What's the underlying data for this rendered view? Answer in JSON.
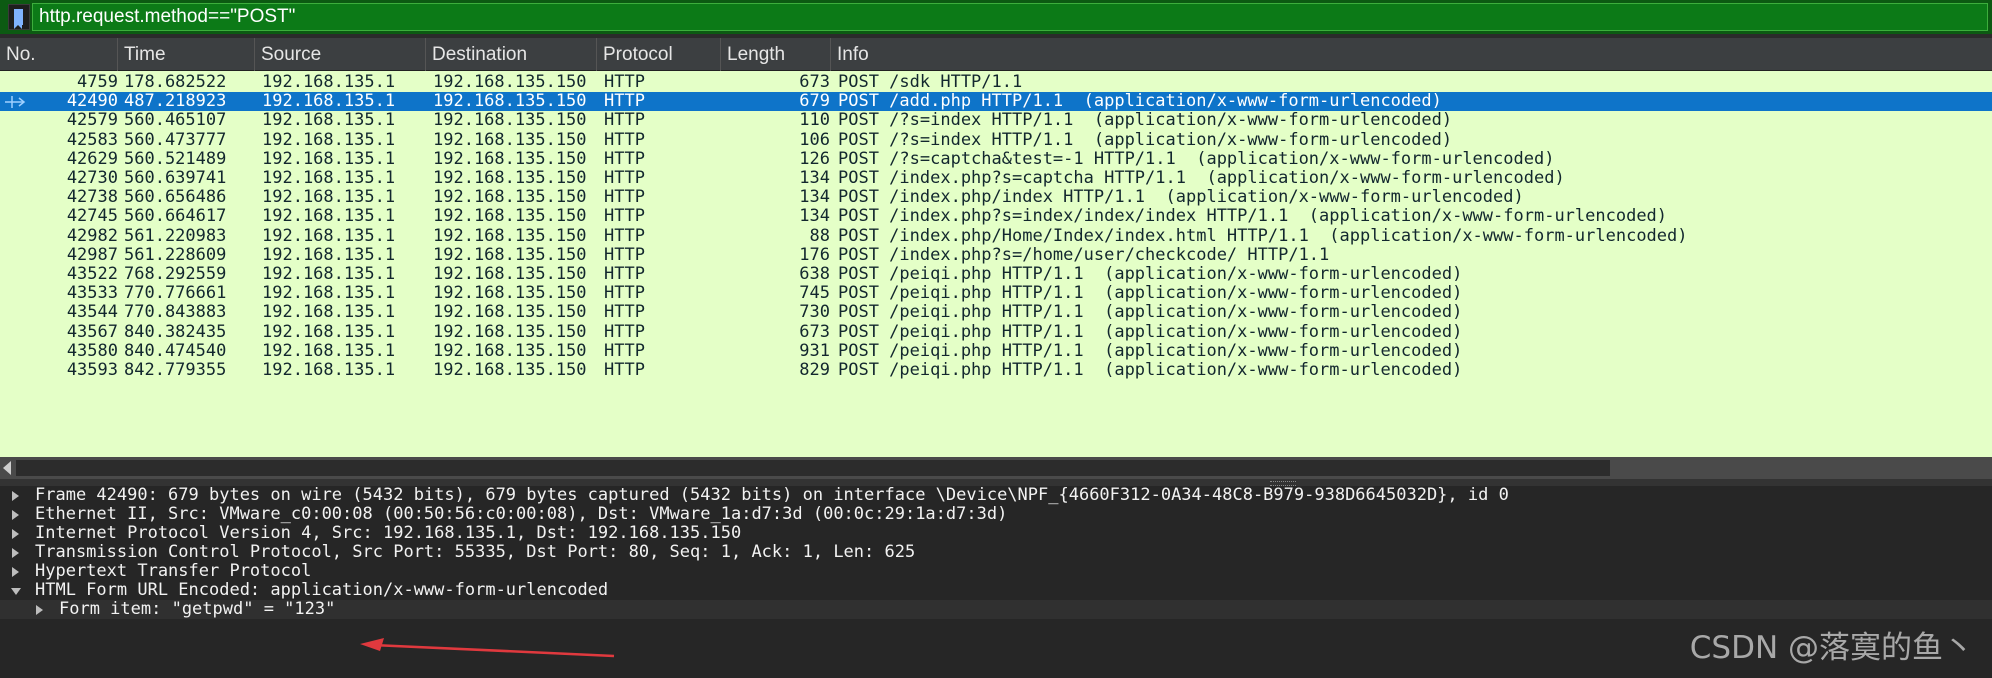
{
  "filter": {
    "value": "http.request.method==\"POST\""
  },
  "columns": [
    "No.",
    "Time",
    "Source",
    "Destination",
    "Protocol",
    "Length",
    "Info"
  ],
  "packets": [
    {
      "no": "4759",
      "time": "178.682522",
      "src": "192.168.135.1",
      "dst": "192.168.135.150",
      "proto": "HTTP",
      "len": "673",
      "info": "POST /sdk HTTP/1.1"
    },
    {
      "no": "42490",
      "time": "487.218923",
      "src": "192.168.135.1",
      "dst": "192.168.135.150",
      "proto": "HTTP",
      "len": "679",
      "info": "POST /add.php HTTP/1.1  (application/x-www-form-urlencoded)"
    },
    {
      "no": "42579",
      "time": "560.465107",
      "src": "192.168.135.1",
      "dst": "192.168.135.150",
      "proto": "HTTP",
      "len": "110",
      "info": "POST /?s=index HTTP/1.1  (application/x-www-form-urlencoded)"
    },
    {
      "no": "42583",
      "time": "560.473777",
      "src": "192.168.135.1",
      "dst": "192.168.135.150",
      "proto": "HTTP",
      "len": "106",
      "info": "POST /?s=index HTTP/1.1  (application/x-www-form-urlencoded)"
    },
    {
      "no": "42629",
      "time": "560.521489",
      "src": "192.168.135.1",
      "dst": "192.168.135.150",
      "proto": "HTTP",
      "len": "126",
      "info": "POST /?s=captcha&test=-1 HTTP/1.1  (application/x-www-form-urlencoded)"
    },
    {
      "no": "42730",
      "time": "560.639741",
      "src": "192.168.135.1",
      "dst": "192.168.135.150",
      "proto": "HTTP",
      "len": "134",
      "info": "POST /index.php?s=captcha HTTP/1.1  (application/x-www-form-urlencoded)"
    },
    {
      "no": "42738",
      "time": "560.656486",
      "src": "192.168.135.1",
      "dst": "192.168.135.150",
      "proto": "HTTP",
      "len": "134",
      "info": "POST /index.php/index HTTP/1.1  (application/x-www-form-urlencoded)"
    },
    {
      "no": "42745",
      "time": "560.664617",
      "src": "192.168.135.1",
      "dst": "192.168.135.150",
      "proto": "HTTP",
      "len": "134",
      "info": "POST /index.php?s=index/index/index HTTP/1.1  (application/x-www-form-urlencoded)"
    },
    {
      "no": "42982",
      "time": "561.220983",
      "src": "192.168.135.1",
      "dst": "192.168.135.150",
      "proto": "HTTP",
      "len": "88",
      "info": "POST /index.php/Home/Index/index.html HTTP/1.1  (application/x-www-form-urlencoded)"
    },
    {
      "no": "42987",
      "time": "561.228609",
      "src": "192.168.135.1",
      "dst": "192.168.135.150",
      "proto": "HTTP",
      "len": "176",
      "info": "POST /index.php?s=/home/user/checkcode/ HTTP/1.1"
    },
    {
      "no": "43522",
      "time": "768.292559",
      "src": "192.168.135.1",
      "dst": "192.168.135.150",
      "proto": "HTTP",
      "len": "638",
      "info": "POST /peiqi.php HTTP/1.1  (application/x-www-form-urlencoded)"
    },
    {
      "no": "43533",
      "time": "770.776661",
      "src": "192.168.135.1",
      "dst": "192.168.135.150",
      "proto": "HTTP",
      "len": "745",
      "info": "POST /peiqi.php HTTP/1.1  (application/x-www-form-urlencoded)"
    },
    {
      "no": "43544",
      "time": "770.843883",
      "src": "192.168.135.1",
      "dst": "192.168.135.150",
      "proto": "HTTP",
      "len": "730",
      "info": "POST /peiqi.php HTTP/1.1  (application/x-www-form-urlencoded)"
    },
    {
      "no": "43567",
      "time": "840.382435",
      "src": "192.168.135.1",
      "dst": "192.168.135.150",
      "proto": "HTTP",
      "len": "673",
      "info": "POST /peiqi.php HTTP/1.1  (application/x-www-form-urlencoded)"
    },
    {
      "no": "43580",
      "time": "840.474540",
      "src": "192.168.135.1",
      "dst": "192.168.135.150",
      "proto": "HTTP",
      "len": "931",
      "info": "POST /peiqi.php HTTP/1.1  (application/x-www-form-urlencoded)"
    },
    {
      "no": "43593",
      "time": "842.779355",
      "src": "192.168.135.1",
      "dst": "192.168.135.150",
      "proto": "HTTP",
      "len": "829",
      "info": "POST /peiqi.php HTTP/1.1  (application/x-www-form-urlencoded)"
    }
  ],
  "selected_packet_index": 1,
  "details": [
    {
      "text": "Frame 42490: 679 bytes on wire (5432 bits), 679 bytes captured (5432 bits) on interface \\Device\\NPF_{4660F312-0A34-48C8-B979-938D6645032D}, id 0",
      "expanded": false
    },
    {
      "text": "Ethernet II, Src: VMware_c0:00:08 (00:50:56:c0:00:08), Dst: VMware_1a:d7:3d (00:0c:29:1a:d7:3d)",
      "expanded": false
    },
    {
      "text": "Internet Protocol Version 4, Src: 192.168.135.1, Dst: 192.168.135.150",
      "expanded": false
    },
    {
      "text": "Transmission Control Protocol, Src Port: 55335, Dst Port: 80, Seq: 1, Ack: 1, Len: 625",
      "expanded": false
    },
    {
      "text": "Hypertext Transfer Protocol",
      "expanded": false
    },
    {
      "text": "HTML Form URL Encoded: application/x-www-form-urlencoded",
      "expanded": true
    },
    {
      "text": "Form item: \"getpwd\" = \"123\"",
      "expanded": false,
      "child": true
    }
  ],
  "watermark": "CSDN @落寞的鱼丶",
  "colors": {
    "filter_bg": "#0c7a17",
    "row_bg": "#e4ffc7",
    "selected_bg": "#0e74c9",
    "annotation_arrow": "#e0393e"
  }
}
